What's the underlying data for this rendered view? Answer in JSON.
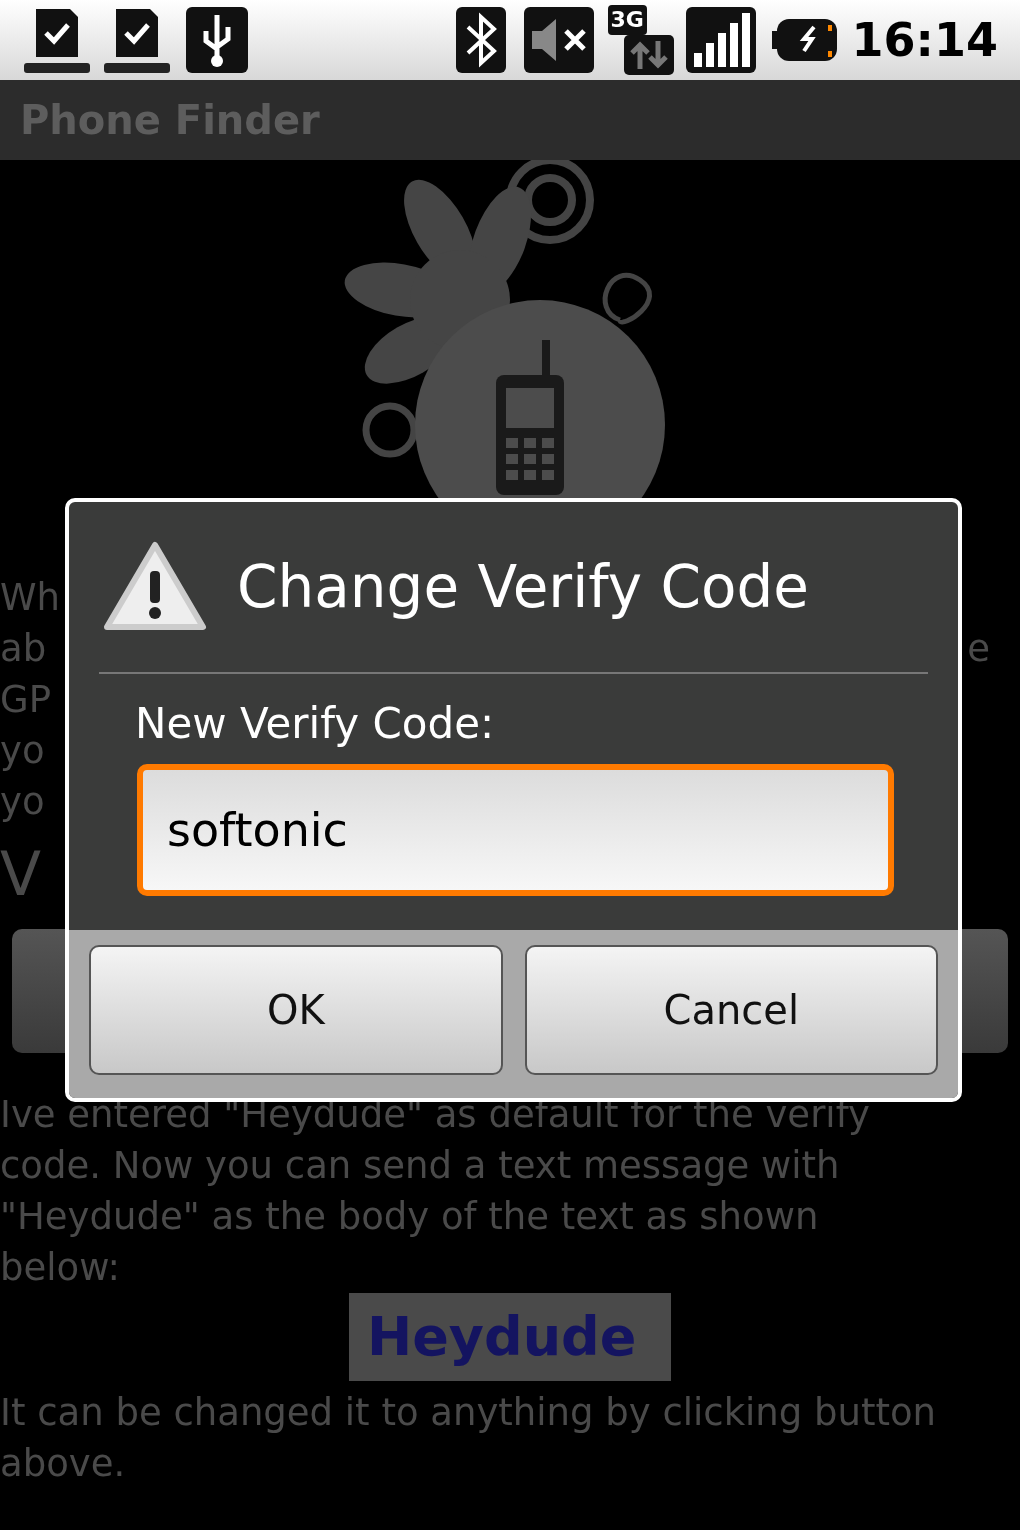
{
  "status_bar": {
    "network": "3G",
    "time": "16:14"
  },
  "app_bar": {
    "title": "Phone Finder"
  },
  "content": {
    "intro_lines": [
      [
        "Wh"
      ],
      [
        "ab",
        "e"
      ],
      [
        "GP"
      ],
      [
        "yo"
      ],
      [
        "yo"
      ]
    ],
    "heading": "V",
    "help_lines": [
      "Ive entered \"Heydude\" as default for the verify",
      "code. Now you can send a text message with",
      "\"Heydude\" as the body of the text as shown",
      "below:"
    ],
    "code_sample": "Heydude",
    "footer_lines": [
      "It can be changed it to anything by clicking button",
      "above."
    ]
  },
  "dialog": {
    "title": "Change Verify Code",
    "field_label": "New Verify Code:",
    "field": {
      "value": "softonic",
      "focused": true
    },
    "buttons": [
      "OK",
      "Cancel"
    ]
  }
}
